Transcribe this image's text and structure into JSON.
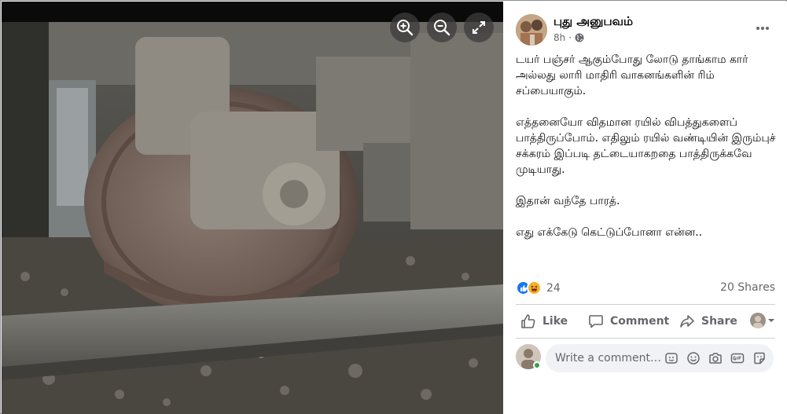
{
  "photo": {
    "zoom_in_icon": "zoom-in-icon",
    "zoom_out_icon": "zoom-out-icon",
    "fullscreen_icon": "fullscreen-icon"
  },
  "post": {
    "page_name": "புது அனுபவம்",
    "time": "8h",
    "audience_icon": "globe-icon",
    "paragraphs": [
      "டயர் பஞ்சர் ஆகும்போது லோடு தாங்காம கார் அல்லது லாரி மாதிரி வாகனங்களின் ரிம் சப்பையாகும்.",
      "எத்தனையோ விதமான ரயில் விபத்துகளைப் பாத்திருப்போம். எதிலும் ரயில் வண்டியின் இரும்புச் சக்கரம் இப்படி தட்டையாகறதை பாத்திருக்கவே முடியாது.",
      "இதான் வந்தே பாரத்.",
      "எது எக்கேடு கெட்டுப்போனா என்ன.."
    ],
    "reaction_count": "24",
    "shares": "20 Shares"
  },
  "actions": {
    "like": "Like",
    "comment": "Comment",
    "share": "Share"
  },
  "comment_box": {
    "placeholder": "Write a comment…"
  },
  "colors": {
    "like_blue": "#1877f2",
    "haha_yellow": "#f7b125",
    "secondary_text": "#65676b",
    "online_green": "#31a24c"
  }
}
